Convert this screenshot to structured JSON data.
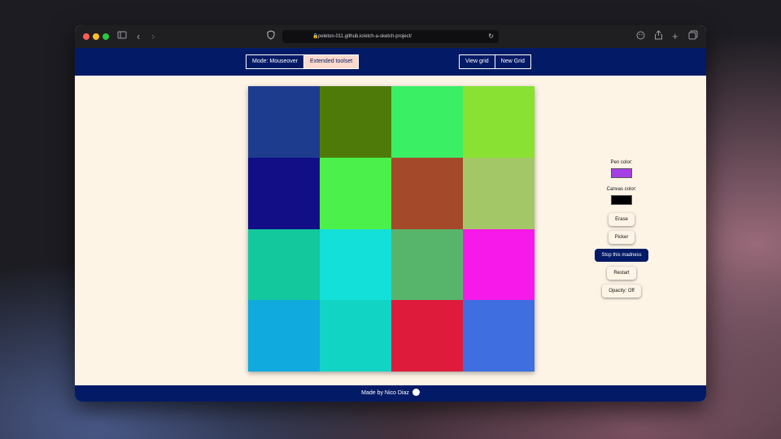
{
  "browser": {
    "url": "peleton-011.github.io/etch-a-sketch-project/"
  },
  "header": {
    "mode_label": "Mode: Mouseover",
    "extended_label": "Extended toolset",
    "view_grid_label": "View grid",
    "new_grid_label": "New Grid"
  },
  "grid": {
    "rows": 4,
    "cols": 4,
    "cells": [
      "#1e3c8e",
      "#4e7a0a",
      "#3bef64",
      "#88e133",
      "#120e85",
      "#4cf04a",
      "#a5492b",
      "#a3c766",
      "#12c89c",
      "#12e0d9",
      "#57b56b",
      "#f719ea",
      "#10aade",
      "#12d4c5",
      "#df1b3b",
      "#3e6ee0"
    ]
  },
  "tools": {
    "pen_color_label": "Pen color:",
    "pen_color": "#a63ee6",
    "canvas_color_label": "Canvas color:",
    "canvas_color": "#000000",
    "erase_label": "Erase",
    "picker_label": "Picker",
    "stop_label": "Stop this madness",
    "restart_label": "Restart",
    "opacity_label": "Opacity: Off"
  },
  "footer": {
    "text": "Made by Nico Diaz",
    "icon": "github-icon"
  }
}
